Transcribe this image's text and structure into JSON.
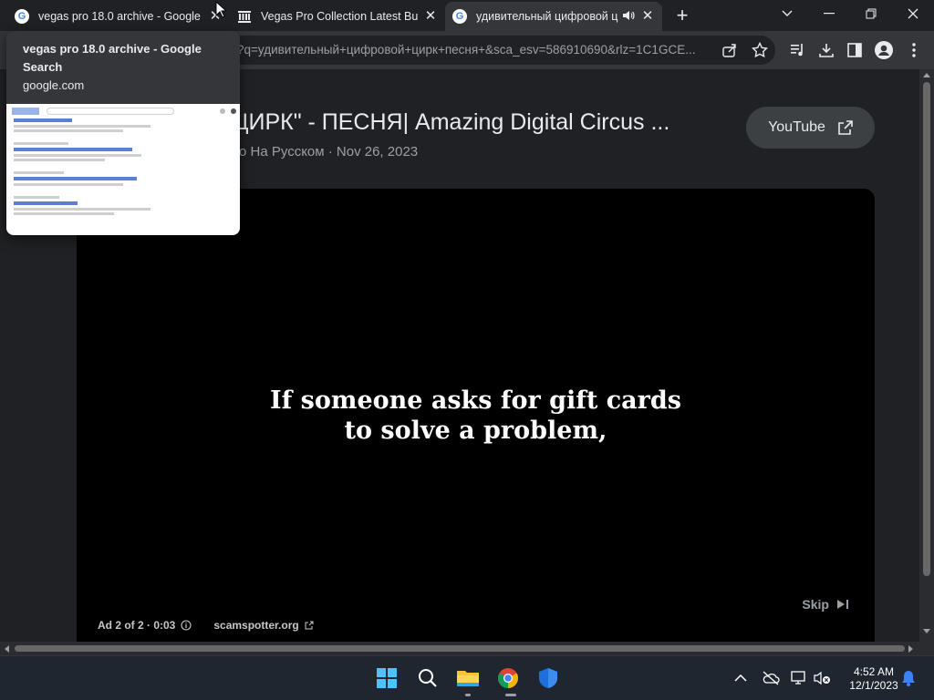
{
  "browser": {
    "tabs": [
      {
        "title": "vegas pro 18.0 archive - Google Search",
        "favicon": "google-icon",
        "active": false
      },
      {
        "title": "Vegas Pro Collection Latest Builds",
        "favicon": "archive-org-icon",
        "active": false
      },
      {
        "title": "удивительный цифровой цирк",
        "favicon": "google-icon",
        "active": true,
        "audio": "speaker-icon"
      }
    ],
    "new_tab_symbol": "+",
    "url": "?q=удивительный+цифровой+цирк+песня+&sca_esv=586910690&rlz=1C1GCE..."
  },
  "hover_card": {
    "title": "vegas pro 18.0 archive - Google Search",
    "domain": "google.com"
  },
  "video": {
    "title": "ЦИРК\" - ПЕСНЯ| Amazing Digital Circus ...",
    "meta": "о На Русском · Nov 26, 2023",
    "youtube_button": "YouTube",
    "caption_line1": "If someone asks for gift cards",
    "caption_line2": "to solve a problem,",
    "skip_label": "Skip",
    "ad_status": "Ad 2 of 2 · 0:03",
    "ad_link": "scamspotter.org"
  },
  "taskbar": {
    "time": "4:52 AM",
    "date": "12/1/2023"
  },
  "colors": {
    "tab_strip": "#202124",
    "toolbar": "#35363a",
    "player": "#000000",
    "taskbar": "#1f2630",
    "notification": "#3b82f6"
  }
}
